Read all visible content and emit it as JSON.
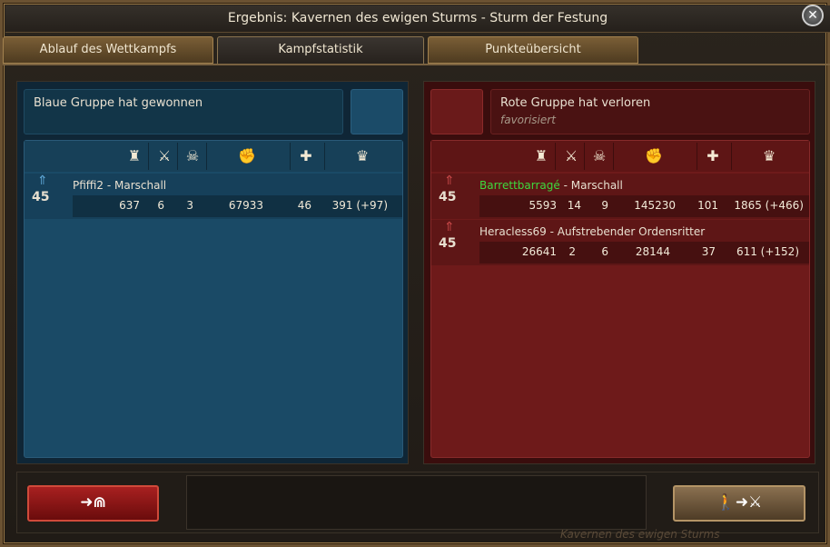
{
  "window": {
    "title": "Ergebnis: Kavernen des ewigen Sturms - Sturm der Festung",
    "close_icon": "close-icon"
  },
  "tabs": [
    {
      "label": "Ablauf des Wettkampfs",
      "active": false
    },
    {
      "label": "Kampfstatistik",
      "active": true
    },
    {
      "label": "Punkteübersicht",
      "active": false
    }
  ],
  "blue": {
    "title": "Blaue Gruppe hat gewonnen",
    "players": [
      {
        "level": "45",
        "name": "Pfiffi2",
        "sep": " - ",
        "rank": "Marschall",
        "stats": [
          "637",
          "6",
          "3",
          "67933",
          "46",
          "391 (+97)"
        ]
      }
    ]
  },
  "red": {
    "title": "Rote Gruppe hat verloren",
    "subtitle": "favorisiert",
    "players": [
      {
        "level": "45",
        "name": "Barrettbarragé",
        "sep": " - ",
        "rank": "Marschall",
        "stats": [
          "5593",
          "14",
          "9",
          "145230",
          "101",
          "1865 (+466)"
        ]
      },
      {
        "level": "45",
        "name": "Heracless69",
        "sep": " - ",
        "rank": "Aufstrebender Ordensritter",
        "stats": [
          "26641",
          "2",
          "6",
          "28144",
          "37",
          "611 (+152)"
        ]
      }
    ]
  },
  "column_icons": [
    "tower-icon",
    "crossed-swords-icon",
    "skull-icon",
    "fist-icon",
    "plus-icon",
    "crown-icon"
  ],
  "buttons": {
    "exit": "➜⋒",
    "fight": "🚶➜⚔"
  },
  "footer_watermark": "Kavernen des ewigen Sturms"
}
